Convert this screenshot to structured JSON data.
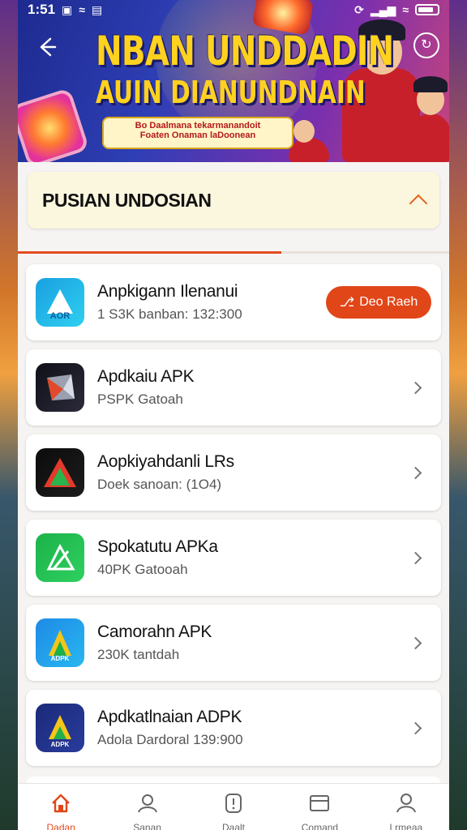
{
  "status_bar": {
    "time": "1:51"
  },
  "banner": {
    "title": "NBAN UNDDADIN",
    "subtitle": "AUIN DIANUNDNAIN",
    "tag_line1": "Bo Daalmana tekarmanandoit",
    "tag_line2": "Foaten Onaman laDoonean"
  },
  "section": {
    "title": "PUSIAN UNDOSIAN",
    "progress": 0.61
  },
  "apps": [
    {
      "name": "Anpkigann Ilenanui",
      "sub": "1 S3K banban: 132:300",
      "action": "Deo Raeh",
      "icon": "aor-app-icon",
      "colors": [
        "#1aa0e0",
        "#2dd0f0"
      ]
    },
    {
      "name": "Apdkaiu APK",
      "sub": "PSPK Gatoah",
      "icon": "prism-app-icon",
      "colors": [
        "#101018",
        "#2a2a3a"
      ]
    },
    {
      "name": "Aopkiyahdanli LRs",
      "sub": "Doek sanoan: (1O4)",
      "icon": "triangle-app-icon",
      "colors": [
        "#0c0c0c",
        "#1c1c1c"
      ]
    },
    {
      "name": "Spokatutu APKa",
      "sub": "40PK Gatooah",
      "icon": "green-drive-icon",
      "colors": [
        "#1cb24a",
        "#2ed060"
      ]
    },
    {
      "name": "Camorahn APK",
      "sub": "230K tantdah",
      "icon": "adpk-app-icon",
      "colors": [
        "#1e8ae6",
        "#28b8f0"
      ]
    },
    {
      "name": "Apdkatlnaian ADPK",
      "sub": "Adola Dardoral 139:900",
      "icon": "drive-app-icon",
      "colors": [
        "#1a2a7a",
        "#2a3c9c"
      ]
    }
  ],
  "bottom_nav": [
    {
      "label": "Dadan",
      "icon": "home-icon",
      "active": true
    },
    {
      "label": "Sanan",
      "icon": "user-icon",
      "active": false
    },
    {
      "label": "Daalt",
      "icon": "alert-icon",
      "active": false
    },
    {
      "label": "Comand",
      "icon": "window-icon",
      "active": false
    },
    {
      "label": "Lrmeaa",
      "icon": "profile-icon",
      "active": false
    }
  ]
}
